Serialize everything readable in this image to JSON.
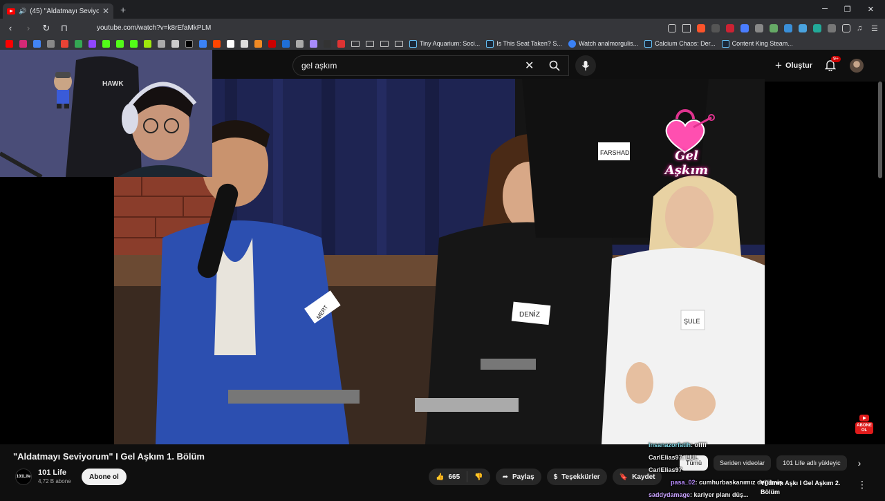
{
  "browser": {
    "tab_title": "(45) \"Aldatmayı Seviyorum\" I",
    "url": "youtube.com/watch?v=k8rEfaMkPLM",
    "bookmarks": [
      "Tiny Aquarium: Soci...",
      "Is This Seat Taken? S...",
      "Watch analmorgulis...",
      "Calcium Chaos: Der...",
      "Content King Steam..."
    ]
  },
  "youtube": {
    "search_query": "gel aşkım",
    "create_label": "Oluştur",
    "notification_count": "9+",
    "video_title": "\"Aldatmayı Seviyorum\" I Gel Aşkım 1. Bölüm",
    "channel_name": "101 Life",
    "channel_avatar_text": "101Life",
    "subscribers": "4,72 B abone",
    "subscribe_label": "Abone ol",
    "likes": "665",
    "share_label": "Paylaş",
    "thanks_label": "Teşekkürler",
    "save_label": "Kaydet",
    "chips": [
      "Tümü",
      "Seriden videolar",
      "101 Life adlı yükleyic"
    ],
    "next_video_title_1": "Yıldırım Aşkı I Gel Aşkım 2.",
    "next_video_title_2": "Bölüm",
    "mini_subscribe": "ABONE OL"
  },
  "video_overlay": {
    "logo_text": "Gel Aşkım",
    "name_tags": [
      "FARSHAD",
      "MERT",
      "DENİZ",
      "ŞULE"
    ],
    "webcam_brand": "HAWK"
  },
  "chat": [
    {
      "user": "insanazorfatih",
      "msg": ": offff"
    },
    {
      "user": "CarlElias97",
      "msg": ": LUL"
    },
    {
      "user": "CarlElias97",
      "msg": ""
    },
    {
      "user": "pasa_02",
      "msg": ": cumhurbaskanımız değilmiş"
    },
    {
      "user": "saddydamage",
      "msg": ": kariyer planı düş..."
    }
  ],
  "colors": {
    "youtube_red": "#ff0000",
    "background": "#0f0f0f",
    "chip_bg": "#272727"
  }
}
